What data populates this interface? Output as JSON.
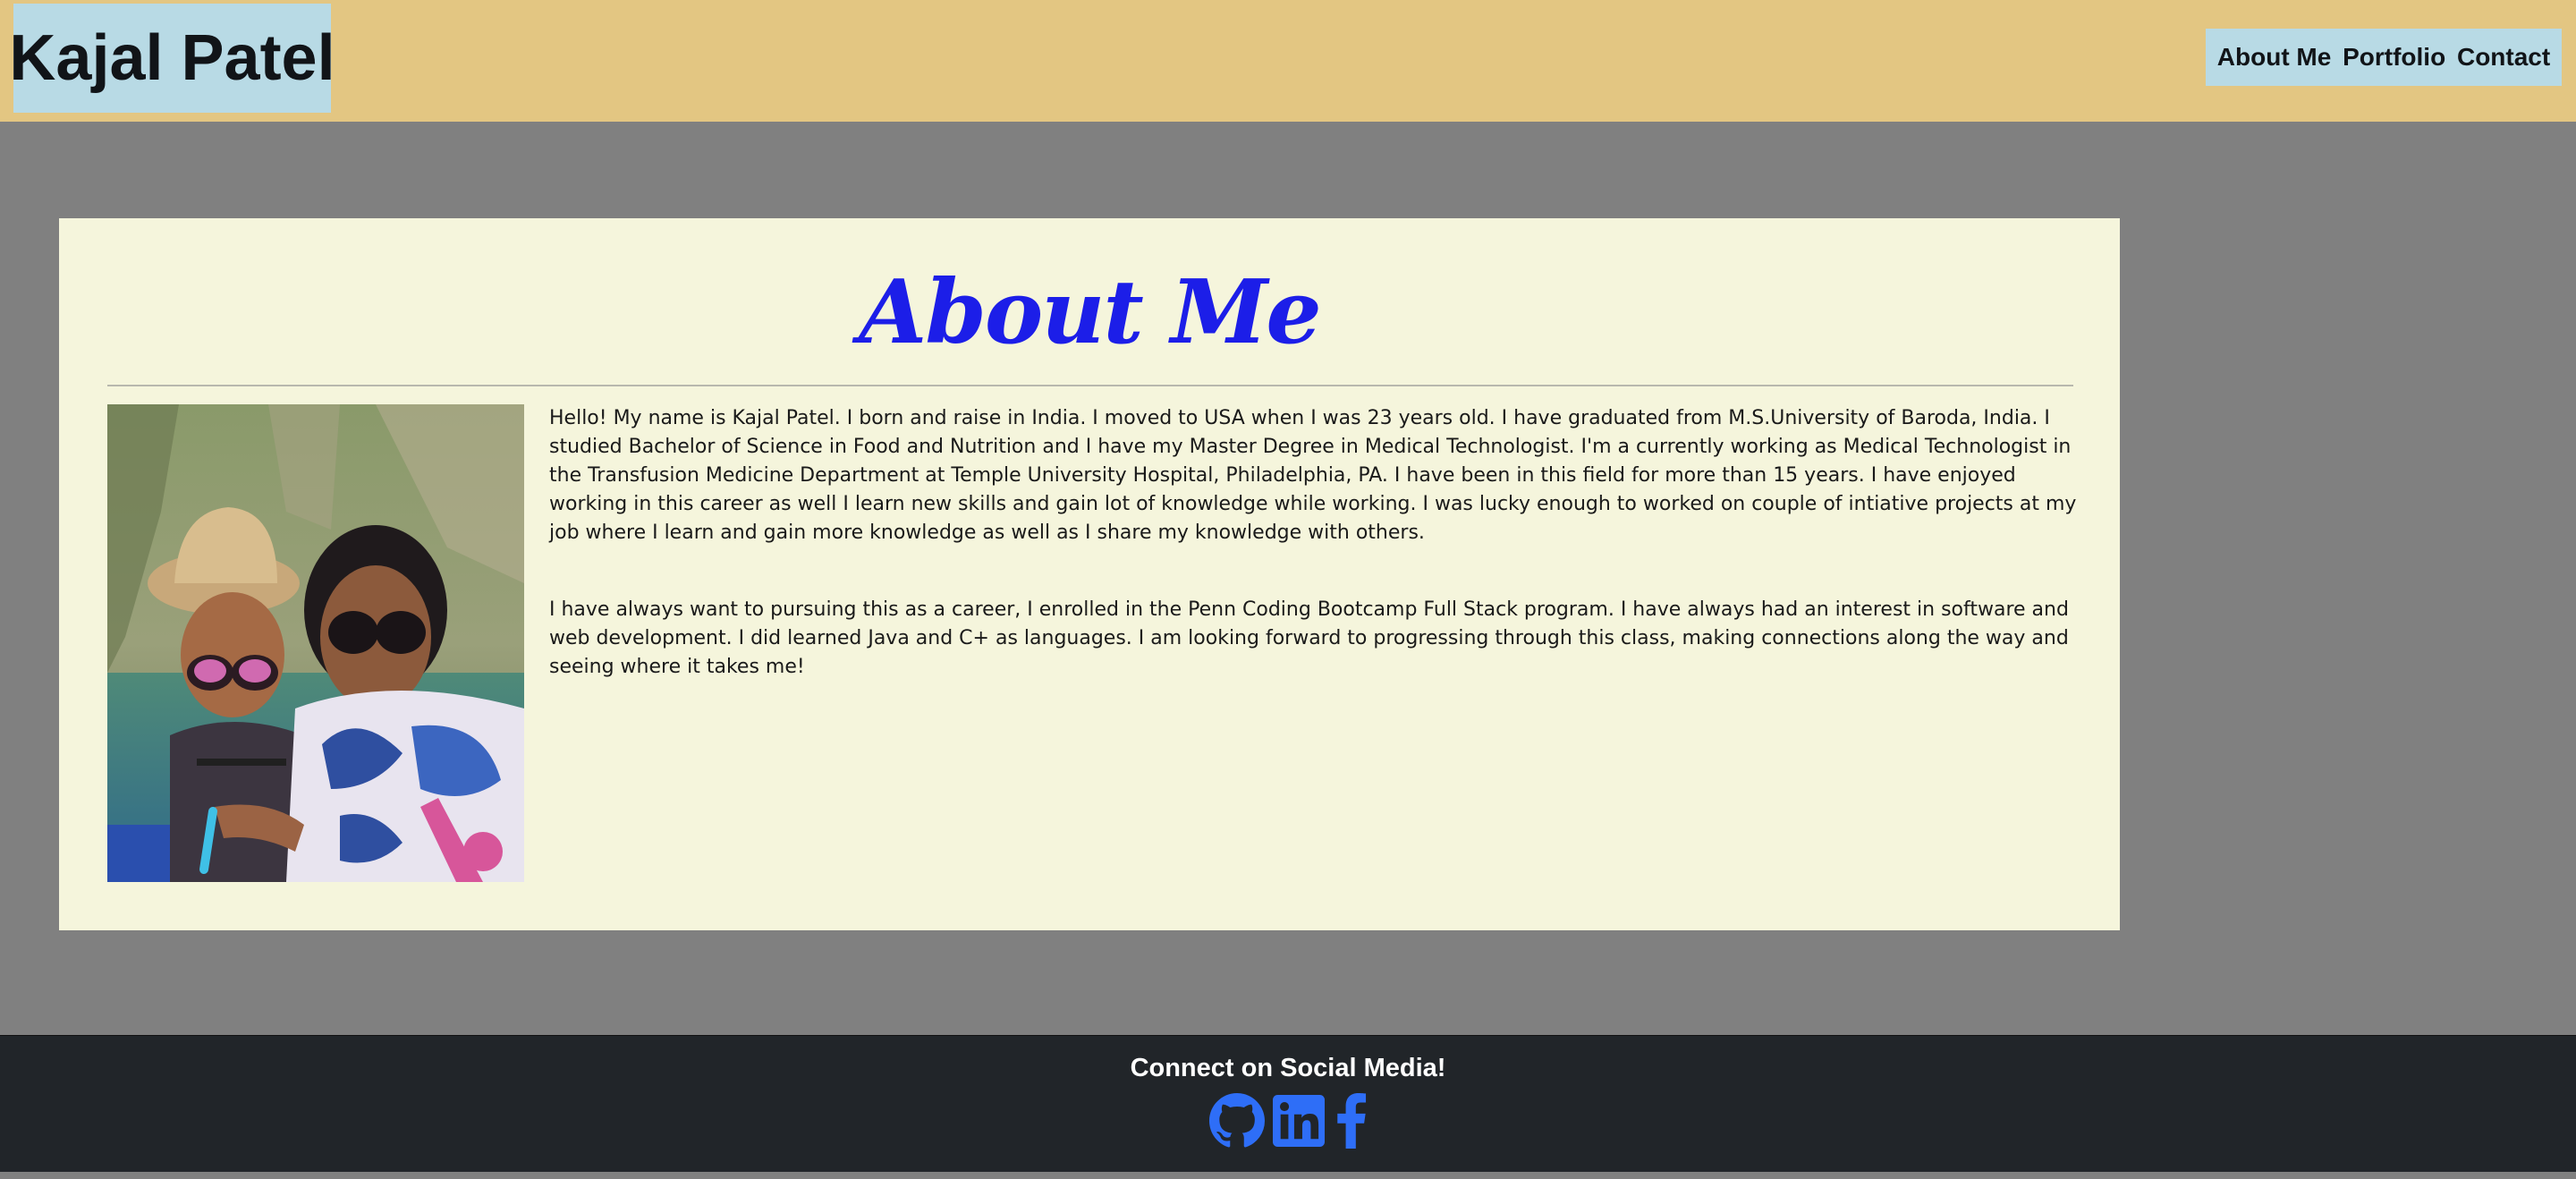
{
  "header": {
    "brand": "Kajal Patel",
    "nav": {
      "about": "About Me",
      "portfolio": "Portfolio",
      "contact": "Contact"
    }
  },
  "about": {
    "title": "About Me",
    "paragraphs": [
      "Hello! My name is Kajal Patel. I born and raise in India. I moved to USA when I was 23 years old. I have graduated from M.S.University of Baroda, India. I studied Bachelor of Science in Food and Nutrition and I have my Master Degree in Medical Technologist. I'm a currently working as Medical Technologist in the Transfusion Medicine Department at Temple University Hospital, Philadelphia, PA. I have been in this field for more than 15 years. I have enjoyed working in this career as well I learn new skills and gain lot of knowledge while working. I was lucky enough to worked on couple of intiative projects at my job where I learn and gain more knowledge as well as I share my knowledge with others.",
      "I have always want to pursuing this as a career, I enrolled in the Penn Coding Bootcamp Full Stack program. I have always had an interest in software and web development. I did learned Java and C+ as languages. I am looking forward to progressing through this class, making connections along the way and seeing where it takes me!"
    ]
  },
  "footer": {
    "title": "Connect on Social Media!",
    "icons": [
      "github-icon",
      "linkedin-icon",
      "facebook-icon"
    ],
    "icon_color": "#2e6ef7"
  },
  "colors": {
    "header_bg": "#e3c682",
    "nav_bg": "#b8dae5",
    "page_bg": "#808080",
    "card_bg": "#f5f5dc",
    "title": "#1c1ee8",
    "footer_bg": "#212529"
  }
}
